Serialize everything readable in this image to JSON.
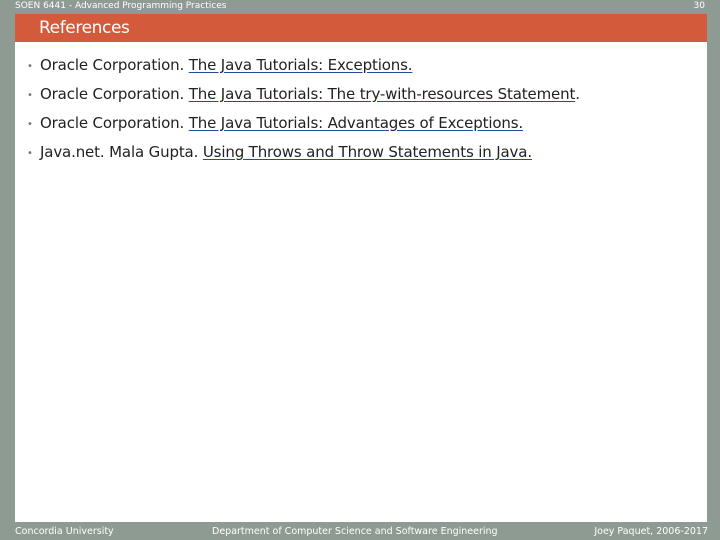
{
  "header": {
    "course": "SOEN 6441 - Advanced Programming Practices",
    "page_number": "30"
  },
  "slide": {
    "title": "References",
    "bullet_glyph": "•",
    "references": [
      {
        "prefix": "Oracle Corporation. ",
        "link": "The Java Tutorials: Exceptions.",
        "suffix": ""
      },
      {
        "prefix": "Oracle Corporation. ",
        "link": "The Java Tutorials: The try-with-resources Statement",
        "suffix": "."
      },
      {
        "prefix": "Oracle Corporation. ",
        "link": "The Java Tutorials: Advantages of Exceptions.",
        "suffix": ""
      },
      {
        "prefix": "Java.net. Mala Gupta. ",
        "link": "Using Throws and Throw Statements in Java.",
        "suffix": ""
      }
    ]
  },
  "footer": {
    "left": "Concordia University",
    "center": "Department of Computer Science and Software Engineering",
    "right": "Joey Paquet, 2006-2017"
  },
  "colors": {
    "frame": "#8e9b93",
    "title_bar": "#d45a3c",
    "link_underline": "#1f4e9c"
  }
}
